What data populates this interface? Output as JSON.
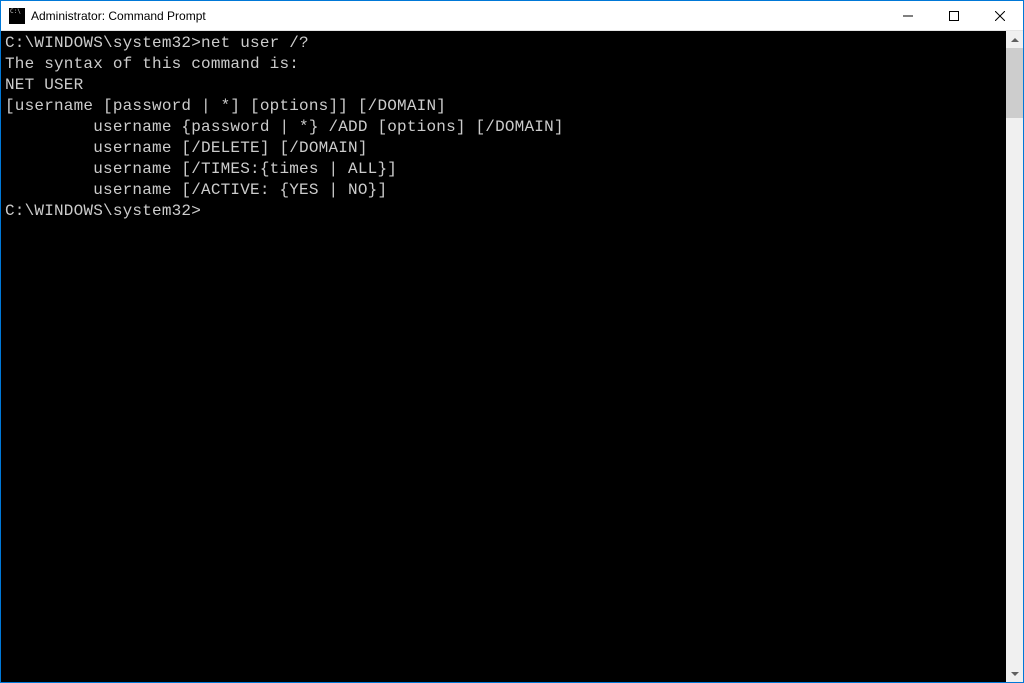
{
  "window": {
    "title": "Administrator: Command Prompt"
  },
  "terminal": {
    "prompt1_path": "C:\\WINDOWS\\system32>",
    "prompt1_cmd": "net user /?",
    "output_lines": [
      "The syntax of this command is:",
      "",
      "NET USER",
      "[username [password | *] [options]] [/DOMAIN]",
      "         username {password | *} /ADD [options] [/DOMAIN]",
      "         username [/DELETE] [/DOMAIN]",
      "         username [/TIMES:{times | ALL}]",
      "         username [/ACTIVE: {YES | NO}]",
      "",
      ""
    ],
    "prompt2_path": "C:\\WINDOWS\\system32>",
    "prompt2_cmd": ""
  }
}
